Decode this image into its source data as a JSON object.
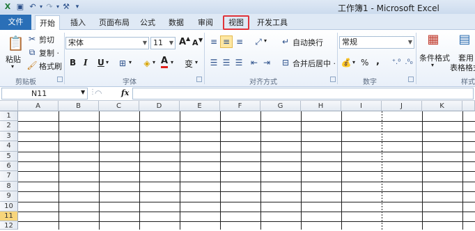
{
  "title": "工作簿1 - Microsoft Excel",
  "quick_access": {
    "save_icon": "save-icon",
    "undo_icon": "undo-icon",
    "redo_icon": "redo-icon",
    "customize_icon": "customize-icon"
  },
  "tabs": {
    "file": "文件",
    "home": "开始",
    "insert": "插入",
    "page_layout": "页面布局",
    "formulas": "公式",
    "data": "数据",
    "review": "审阅",
    "view": "视图",
    "developer": "开发工具"
  },
  "ribbon": {
    "clipboard": {
      "paste": "粘贴",
      "cut": "剪切",
      "copy": "复制 ·",
      "format_painter": "格式刷",
      "group": "剪贴板"
    },
    "font": {
      "font_name": "宋体",
      "font_size": "11",
      "grow": "A",
      "shrink": "A",
      "bold": "B",
      "italic": "I",
      "underline": "U",
      "wen": "变",
      "group": "字体"
    },
    "alignment": {
      "wrap_text": "自动换行",
      "merge_center": "合并后居中 ·",
      "group": "对齐方式"
    },
    "number": {
      "format": "常规",
      "percent": "%",
      "comma": ",",
      "group": "数字"
    },
    "styles": {
      "conditional": "条件格式",
      "format_table_1": "套用",
      "format_table_2": "表格格式",
      "group": "样式"
    }
  },
  "formula_bar": {
    "name_box": "N11",
    "fx": "fx",
    "content": ""
  },
  "grid": {
    "columns": [
      "A",
      "B",
      "C",
      "D",
      "E",
      "F",
      "G",
      "H",
      "I",
      "J",
      "K"
    ],
    "rows": [
      "1",
      "2",
      "3",
      "4",
      "5",
      "6",
      "7",
      "8",
      "9",
      "10",
      "11",
      "12"
    ],
    "selected_row": "11"
  },
  "colors": {
    "file_tab": "#2a6fb7",
    "highlight_box": "#e0333a",
    "selected_row": "#f7d57b"
  }
}
